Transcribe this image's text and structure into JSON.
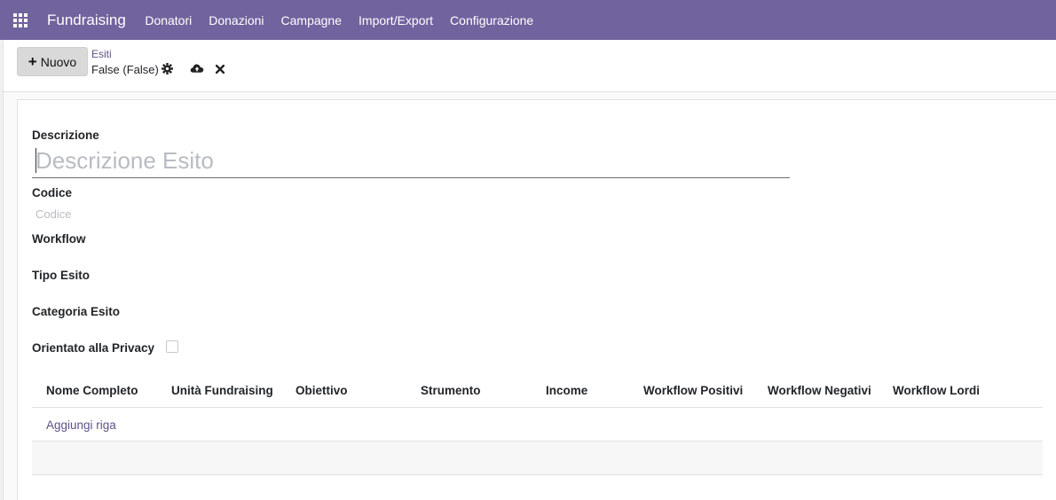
{
  "navbar": {
    "brand": "Fundraising",
    "menu": [
      "Donatori",
      "Donazioni",
      "Campagne",
      "Import/Export",
      "Configurazione"
    ],
    "bg_color": "#71639e"
  },
  "control_panel": {
    "new_button": "Nuovo",
    "breadcrumb_parent": "Esiti",
    "record_name": "False (False)",
    "icons": [
      "gear-icon",
      "cloud-upload-icon",
      "close-icon"
    ]
  },
  "form": {
    "description_label": "Descrizione",
    "description_placeholder": "Descrizione Esito",
    "code_label": "Codice",
    "code_placeholder": "Codice",
    "workflow_label": "Workflow",
    "type_label": "Tipo Esito",
    "category_label": "Categoria Esito",
    "privacy_label": "Orientato alla Privacy",
    "privacy_checked": false
  },
  "table": {
    "columns": [
      "Nome Completo",
      "Unità Fundraising",
      "Obiettivo",
      "Strumento",
      "Income",
      "Workflow Positivi",
      "Workflow Negativi",
      "Workflow Lordi"
    ],
    "add_line": "Aggiungi riga",
    "rows": []
  }
}
